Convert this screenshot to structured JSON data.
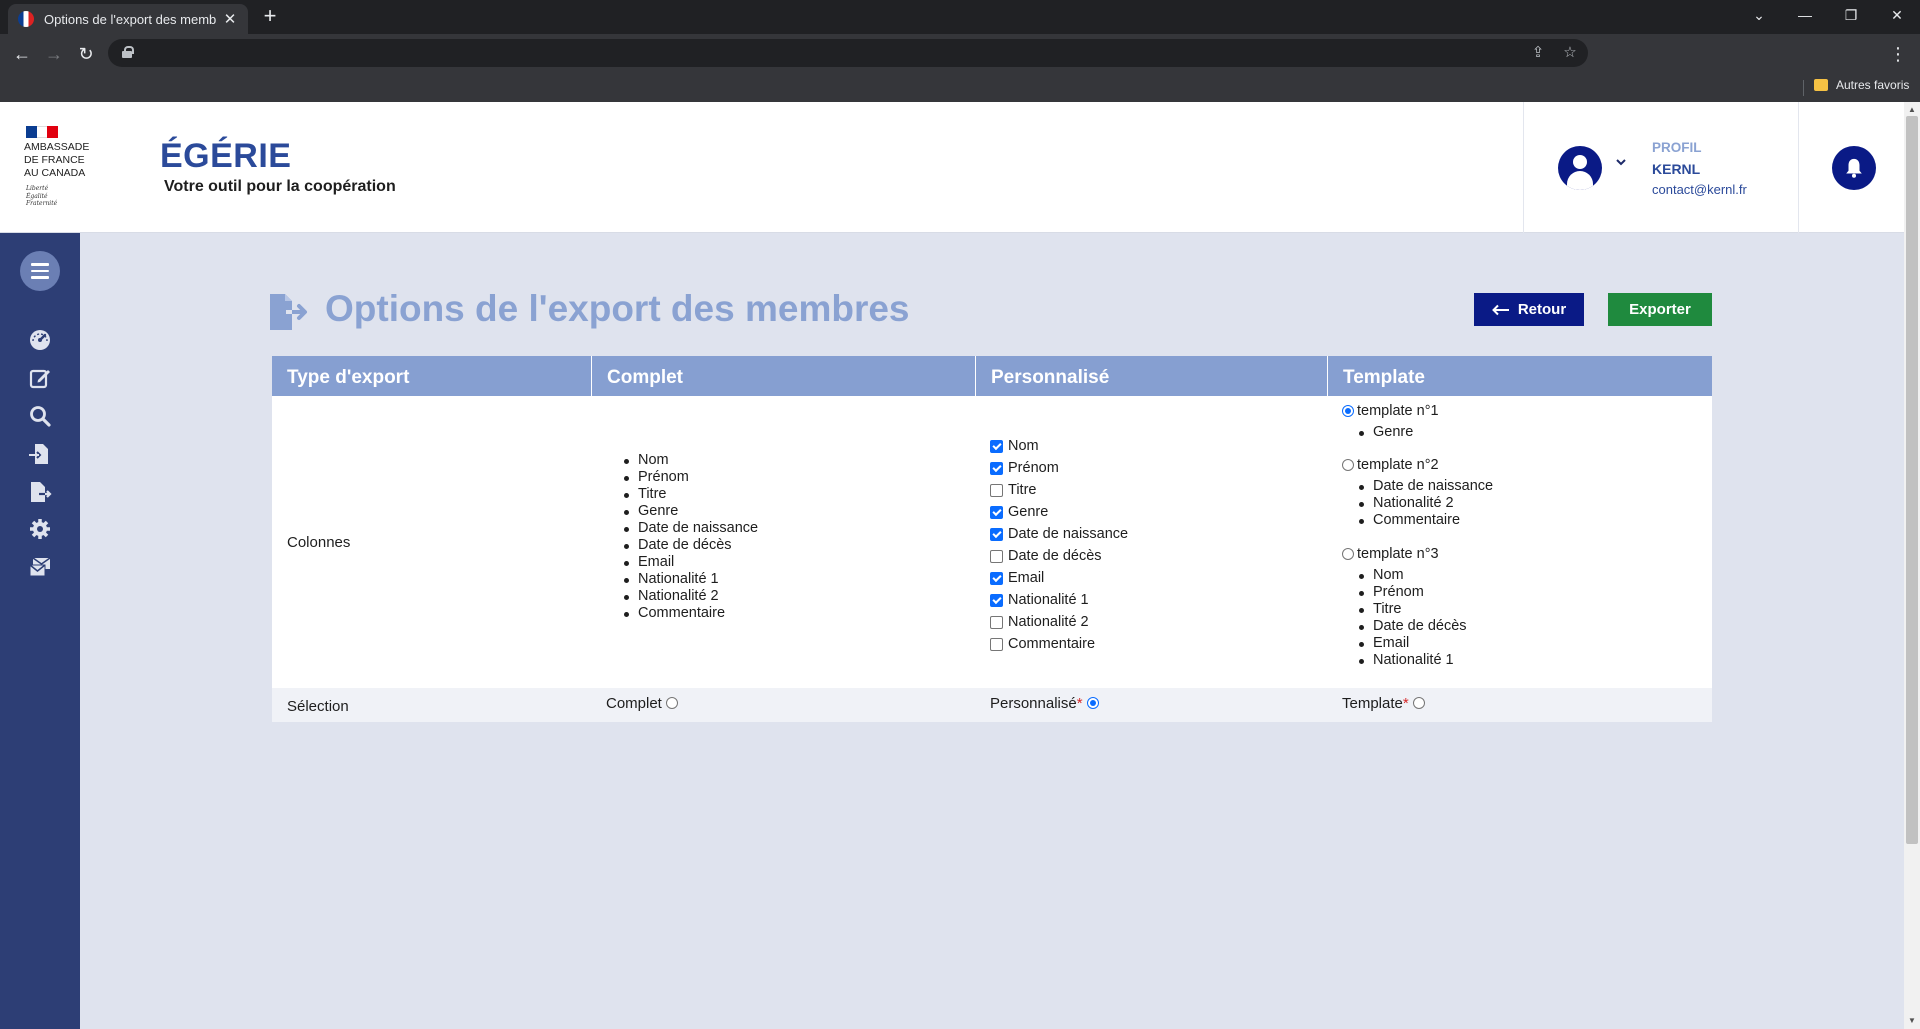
{
  "browser": {
    "tab_title": "Options de l'export des membres",
    "bookmark_folder": "Autres favoris"
  },
  "header": {
    "ambassade_lines": [
      "AMBASSADE",
      "DE FRANCE",
      "AU CANADA"
    ],
    "devise_lines": [
      "Liberté",
      "Égalité",
      "Fraternité"
    ],
    "app_name": "ÉGÉRIE",
    "tagline": "Votre outil pour la coopération",
    "profile": {
      "label": "PROFIL",
      "name": "KERNL",
      "email": "contact@kernl.fr"
    }
  },
  "sidebar": {
    "icons": [
      "dashboard-icon",
      "edit-icon",
      "search-icon",
      "import-icon",
      "export-icon",
      "settings-icon",
      "mail-icon"
    ]
  },
  "page": {
    "title": "Options de l'export des membres",
    "back_label": "Retour",
    "export_label": "Exporter"
  },
  "table": {
    "headers": [
      "Type d'export",
      "Complet",
      "Personnalisé",
      "Template"
    ],
    "row_labels": {
      "columns": "Colonnes",
      "selection": "Sélection"
    },
    "complet_columns": [
      "Nom",
      "Prénom",
      "Titre",
      "Genre",
      "Date de naissance",
      "Date de décès",
      "Email",
      "Nationalité 1",
      "Nationalité 2",
      "Commentaire"
    ],
    "custom_columns": [
      {
        "label": "Nom",
        "checked": true
      },
      {
        "label": "Prénom",
        "checked": true
      },
      {
        "label": "Titre",
        "checked": false
      },
      {
        "label": "Genre",
        "checked": true
      },
      {
        "label": "Date de naissance",
        "checked": true
      },
      {
        "label": "Date de décès",
        "checked": false
      },
      {
        "label": "Email",
        "checked": true
      },
      {
        "label": "Nationalité 1",
        "checked": true
      },
      {
        "label": "Nationalité 2",
        "checked": false
      },
      {
        "label": "Commentaire",
        "checked": false
      }
    ],
    "templates": [
      {
        "label": "template n°1",
        "selected": true,
        "columns": [
          "Genre"
        ]
      },
      {
        "label": "template n°2",
        "selected": false,
        "columns": [
          "Date de naissance",
          "Nationalité 2",
          "Commentaire"
        ]
      },
      {
        "label": "template n°3",
        "selected": false,
        "columns": [
          "Nom",
          "Prénom",
          "Titre",
          "Date de décès",
          "Email",
          "Nationalité 1"
        ]
      }
    ],
    "selection": {
      "complet": "Complet",
      "personnalise": "Personnalisé",
      "template": "Template",
      "required_mark": "*",
      "selected": "personnalise"
    }
  },
  "colors": {
    "primary": "#0a1a86",
    "success": "#1f8a3e",
    "table_header": "#869fd1",
    "sidebar": "#2d3e75",
    "title": "#8aa2d2"
  }
}
